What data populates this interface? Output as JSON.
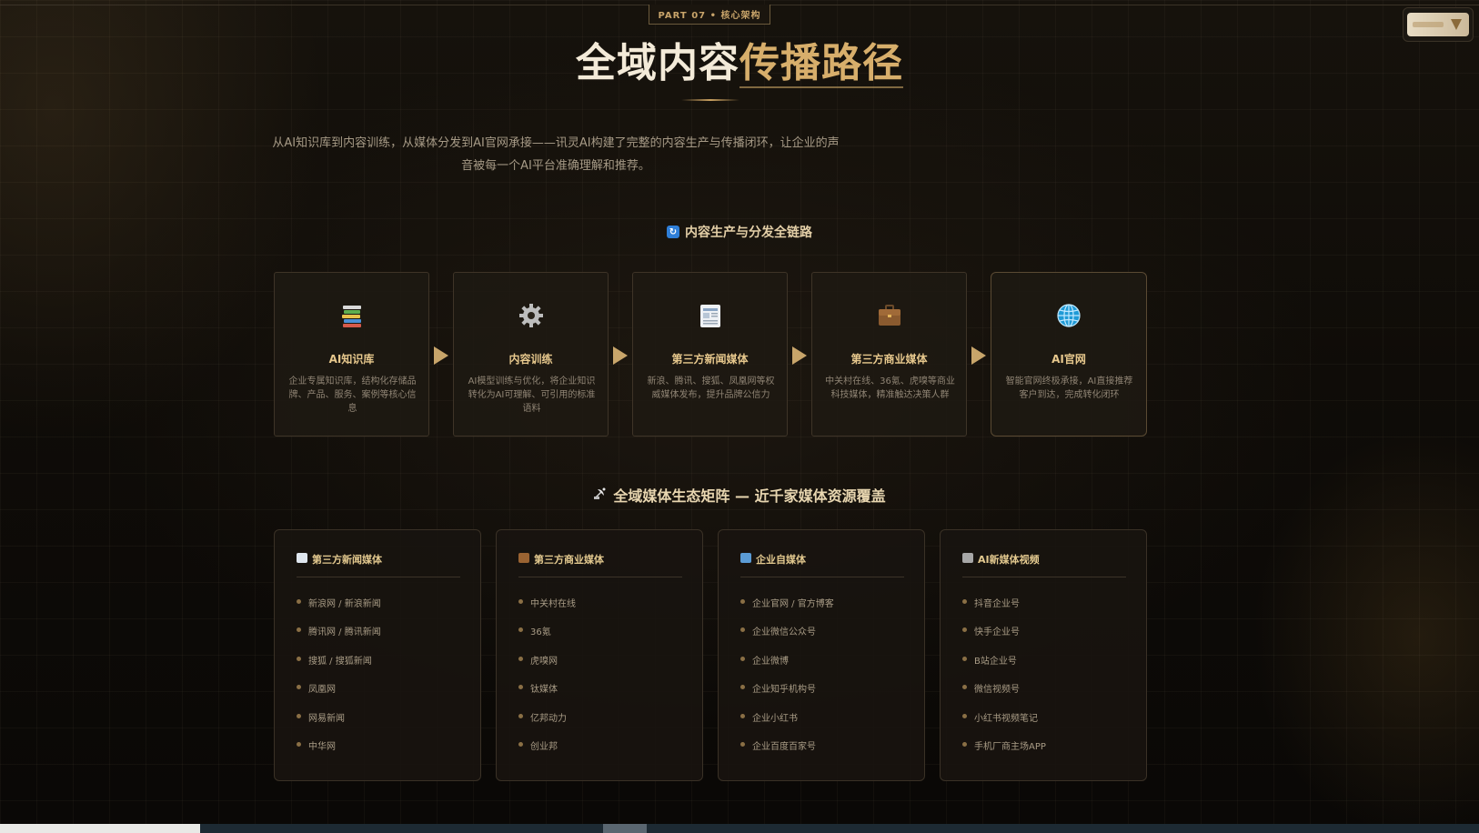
{
  "part_tag": "PART 07 • 核心架构",
  "title": {
    "part1": "全域内容",
    "part2": "传播路径"
  },
  "intro": "从AI知识库到内容训练，从媒体分发到AI官网承接——讯灵AI构建了完整的内容生产与传播闭环，让企业的声音被每一个AI平台准确理解和推荐。",
  "chain_section": {
    "icon": "refresh-icon",
    "title": "内容生产与分发全链路"
  },
  "flow": [
    {
      "icon": "books-icon",
      "title": "AI知识库",
      "desc": "企业专属知识库，结构化存储品牌、产品、服务、案例等核心信息"
    },
    {
      "icon": "gear-icon",
      "title": "内容训练",
      "desc": "AI模型训练与优化，将企业知识转化为AI可理解、可引用的标准语料"
    },
    {
      "icon": "newspaper-icon",
      "title": "第三方新闻媒体",
      "desc": "新浪、腾讯、搜狐、凤凰网等权威媒体发布，提升品牌公信力"
    },
    {
      "icon": "briefcase-icon",
      "title": "第三方商业媒体",
      "desc": "中关村在线、36氪、虎嗅等商业科技媒体，精准触达决策人群"
    },
    {
      "icon": "globe-icon",
      "title": "AI官网",
      "desc": "智能官网终极承接，AI直接推荐客户到达，完成转化闭环"
    }
  ],
  "matrix_section": {
    "icon": "satellite-icon",
    "title": "全域媒体生态矩阵 — 近千家媒体资源覆盖"
  },
  "media": [
    {
      "icon": "newspaper-icon",
      "title": "第三方新闻媒体",
      "items": [
        "新浪网 / 新浪新闻",
        "腾讯网 / 腾讯新闻",
        "搜狐 / 搜狐新闻",
        "凤凰网",
        "网易新闻",
        "中华网"
      ]
    },
    {
      "icon": "briefcase-icon",
      "title": "第三方商业媒体",
      "items": [
        "中关村在线",
        "36氪",
        "虎嗅网",
        "钛媒体",
        "亿邦动力",
        "创业邦"
      ]
    },
    {
      "icon": "building-icon",
      "title": "企业自媒体",
      "items": [
        "企业官网 / 官方博客",
        "企业微信公众号",
        "企业微博",
        "企业知乎机构号",
        "企业小红书",
        "企业百度百家号"
      ]
    },
    {
      "icon": "clapper-icon",
      "title": "AI新媒体视频",
      "items": [
        "抖音企业号",
        "快手企业号",
        "B站企业号",
        "微信视频号",
        "小红书视频笔记",
        "手机厂商主场APP"
      ]
    }
  ],
  "colors": {
    "accent": "#d7ae6b",
    "background": "#0b0907",
    "card": "#1e1912"
  }
}
